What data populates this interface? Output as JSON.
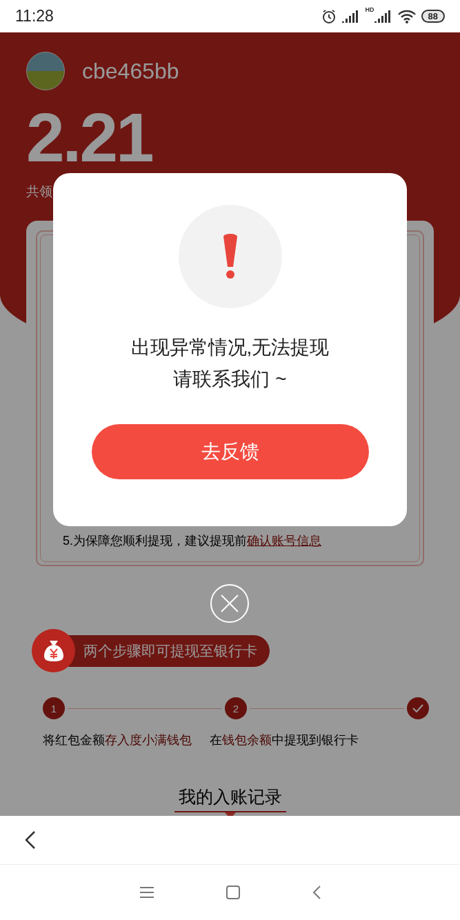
{
  "status_bar": {
    "time": "11:28",
    "network": "HD",
    "battery": "88"
  },
  "profile": {
    "username": "cbe465bb",
    "amount": "2.21",
    "caption": "共领"
  },
  "notice_card": {
    "tip": {
      "text": "5.为保障您顺利提现，建议提现前",
      "link": "确认账号信息"
    }
  },
  "dialog": {
    "message_lines": [
      "出现异常情况,无法提现",
      "请联系我们 ~"
    ],
    "button": "去反馈"
  },
  "steps": {
    "title": "两个步骤即可提现至银行卡",
    "items": [
      {
        "kind": "number",
        "badge": "1",
        "parts": [
          {
            "text": "将红包金额",
            "highlight": false
          },
          {
            "text": "存入度小满钱包",
            "highlight": true
          }
        ]
      },
      {
        "kind": "number",
        "badge": "2",
        "parts": [
          {
            "text": "在",
            "highlight": false
          },
          {
            "text": "钱包余额",
            "highlight": true
          },
          {
            "text": "中提现到银行卡",
            "highlight": false
          }
        ]
      },
      {
        "kind": "check"
      }
    ]
  },
  "records_tab": {
    "label": "我的入账记录",
    "selected": true
  }
}
